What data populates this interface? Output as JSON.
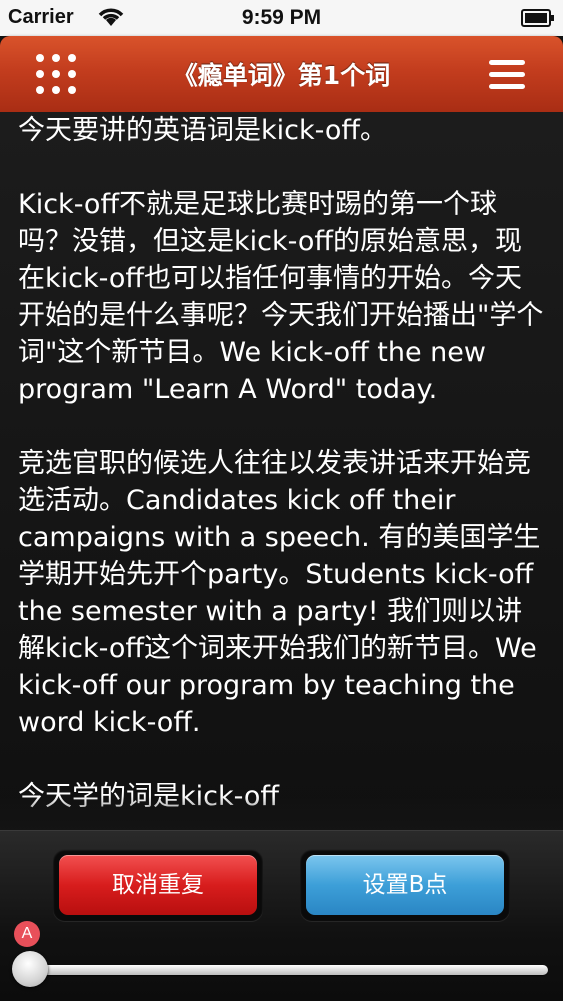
{
  "status_bar": {
    "carrier": "Carrier",
    "time": "9:59 PM",
    "icons": [
      "wifi-icon",
      "battery-icon"
    ]
  },
  "nav_bar": {
    "title": "《瘾单词》第1个词",
    "left_icon": "grid-icon",
    "right_icon": "menu-icon",
    "color": "#c33d1e"
  },
  "content": {
    "text": "今天要讲的英语词是kick-off。\n\nKick-off不就是足球比赛时踢的第一个球吗？没错，但这是kick-off的原始意思，现在kick-off也可以指任何事情的开始。今天开始的是什么事呢？今天我们开始播出\"学个词\"这个新节目。We kick-off the new program \"Learn A Word\" today.\n\n竞选官职的候选人往往以发表讲话来开始竞选活动。Candidates kick off their campaigns with a speech. 有的美国学生学期开始先开个party。Students kick-off the semester with a party! 我们则以讲解kick-off这个词来开始我们的新节目。We kick-off our program by teaching the word kick-off.\n\n今天学的词是kick-off"
  },
  "toolbar": {
    "cancel_repeat_label": "取消重复",
    "set_b_label": "设置B点",
    "marker_a_label": "A",
    "progress": 0.0,
    "colors": {
      "cancel_button": "#d81d1d",
      "set_b_button": "#3d9fd8",
      "marker": "#e8505a"
    }
  }
}
